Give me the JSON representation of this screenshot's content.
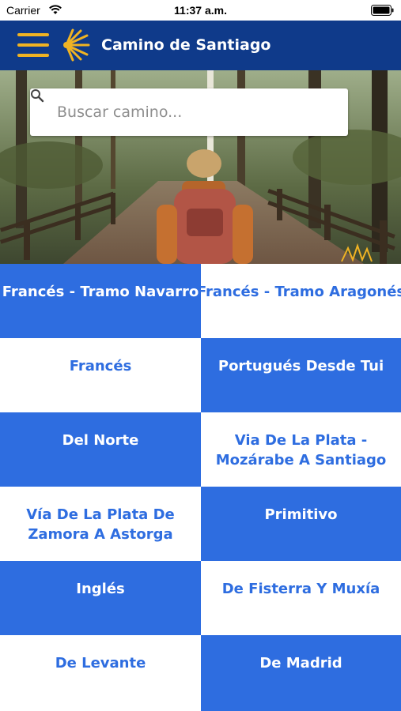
{
  "status_bar": {
    "carrier": "Carrier",
    "time": "11:37 a.m."
  },
  "nav": {
    "title": "Camino de Santiago",
    "menu_icon": "hamburger-menu-icon",
    "logo_icon": "scallop-shell-icon"
  },
  "search": {
    "placeholder": "Buscar camino...",
    "value": ""
  },
  "colors": {
    "nav_bg": "#0f3a8a",
    "accent_yellow": "#f0b323",
    "cell_blue": "#2e6de0",
    "cell_white": "#ffffff"
  },
  "routes": [
    {
      "label": "Francés - Tramo Navarro",
      "style": "blue"
    },
    {
      "label": "Francés - Tramo Aragonés",
      "style": "white"
    },
    {
      "label": "Francés",
      "style": "white"
    },
    {
      "label": "Portugués Desde Tui",
      "style": "blue"
    },
    {
      "label": "Del Norte",
      "style": "blue"
    },
    {
      "label": "Via De La Plata - Mozárabe A Santiago",
      "style": "white"
    },
    {
      "label": "Vía De La Plata De Zamora A Astorga",
      "style": "white"
    },
    {
      "label": "Primitivo",
      "style": "blue"
    },
    {
      "label": "Inglés",
      "style": "blue"
    },
    {
      "label": "De Fisterra Y Muxía",
      "style": "white"
    },
    {
      "label": "De Levante",
      "style": "white"
    },
    {
      "label": "De Madrid",
      "style": "blue"
    }
  ]
}
